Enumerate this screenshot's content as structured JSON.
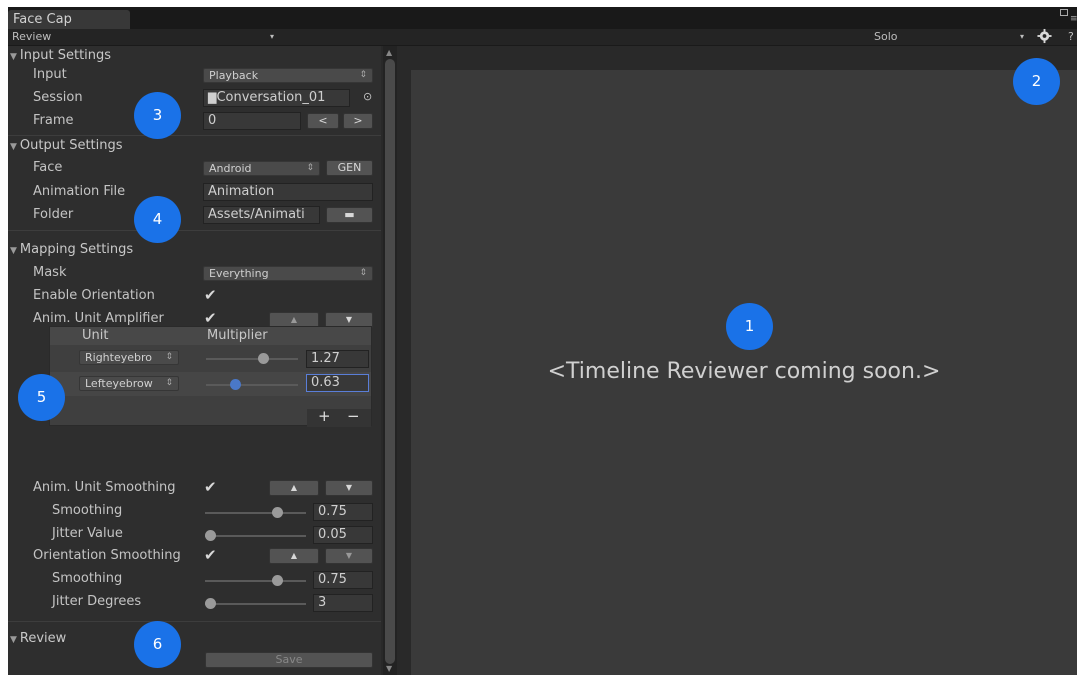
{
  "window": {
    "tab_title": "Face Cap"
  },
  "toolbar": {
    "mode": "Review",
    "mode_arrow": "▾",
    "solo": "Solo",
    "solo_arrow": "▾"
  },
  "input_settings": {
    "header": "Input Settings",
    "input_label": "Input",
    "input_value": "Playback",
    "session_label": "Session",
    "session_value": "Conversation_01",
    "frame_label": "Frame",
    "frame_value": "0",
    "prev": "<",
    "next": ">"
  },
  "output_settings": {
    "header": "Output Settings",
    "face_label": "Face",
    "face_value": "Android",
    "gen": "GEN",
    "anim_file_label": "Animation File",
    "anim_file_value": "Animation",
    "folder_label": "Folder",
    "folder_value": "Assets/Animati"
  },
  "mapping_settings": {
    "header": "Mapping Settings",
    "mask_label": "Mask",
    "mask_value": "Everything",
    "enable_orientation_label": "Enable Orientation",
    "amplifier_label": "Anim. Unit Amplifier",
    "col_unit": "Unit",
    "col_multiplier": "Multiplier",
    "rows": [
      {
        "unit": "Righteyebro",
        "value": "1.27",
        "level": 0.62
      },
      {
        "unit": "Lefteyebrow",
        "value": "0.63",
        "level": 0.31
      }
    ],
    "add": "+",
    "remove": "−",
    "smoothing_label": "Anim. Unit Smoothing",
    "smoothing_sub": "Smoothing",
    "smoothing_value": "0.75",
    "jitter_label": "Jitter Value",
    "jitter_value": "0.05",
    "orient_smoothing_label": "Orientation Smoothing",
    "orient_smoothing_sub": "Smoothing",
    "orient_smoothing_value": "0.75",
    "jitter_degrees_label": "Jitter Degrees",
    "jitter_degrees_value": "3",
    "up": "▲",
    "down": "▼"
  },
  "review": {
    "header": "Review",
    "save": "Save"
  },
  "viewport": {
    "message": "<Timeline Reviewer coming soon.>"
  },
  "badges": [
    "1",
    "2",
    "3",
    "4",
    "5",
    "6"
  ],
  "colors": {
    "badge": "#1a72e8",
    "panel": "#2e2e2e",
    "viewport": "#3a3a3a"
  }
}
